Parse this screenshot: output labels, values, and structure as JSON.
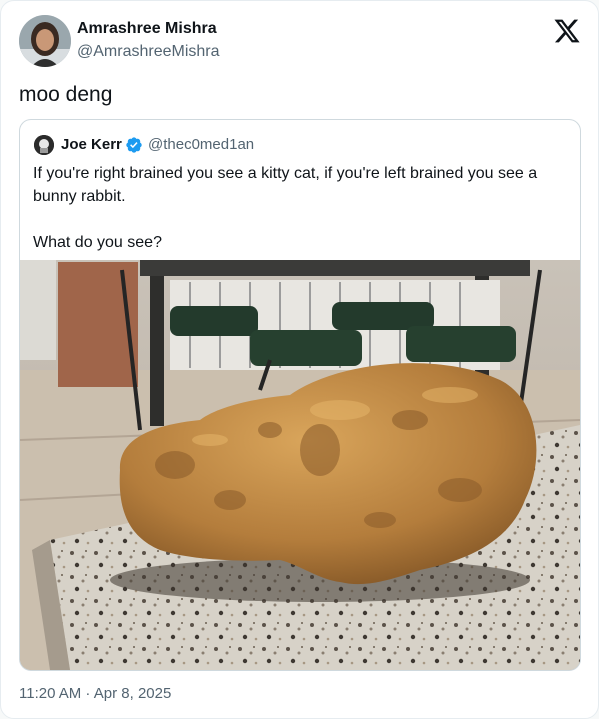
{
  "tweet": {
    "author_name": "Amrashree Mishra",
    "author_handle": "@AmrashreeMishra",
    "text": "moo deng",
    "timestamp": "11:20 AM · Apr 8, 2025",
    "platform_icon": "x-logo-icon"
  },
  "quoted_tweet": {
    "author_name": "Joe Kerr",
    "author_handle": "@thec0med1an",
    "verified": true,
    "text": "If you're right brained you see a kitty cat, if you're left brained you see a bunny rabbit.\n\nWhat do you see?",
    "image_description": "photo-of-potato-on-granite-counter"
  },
  "colors": {
    "text_primary": "#0f1419",
    "text_secondary": "#536471",
    "verified_blue": "#1d9bf0",
    "border": "#cfd9de"
  }
}
